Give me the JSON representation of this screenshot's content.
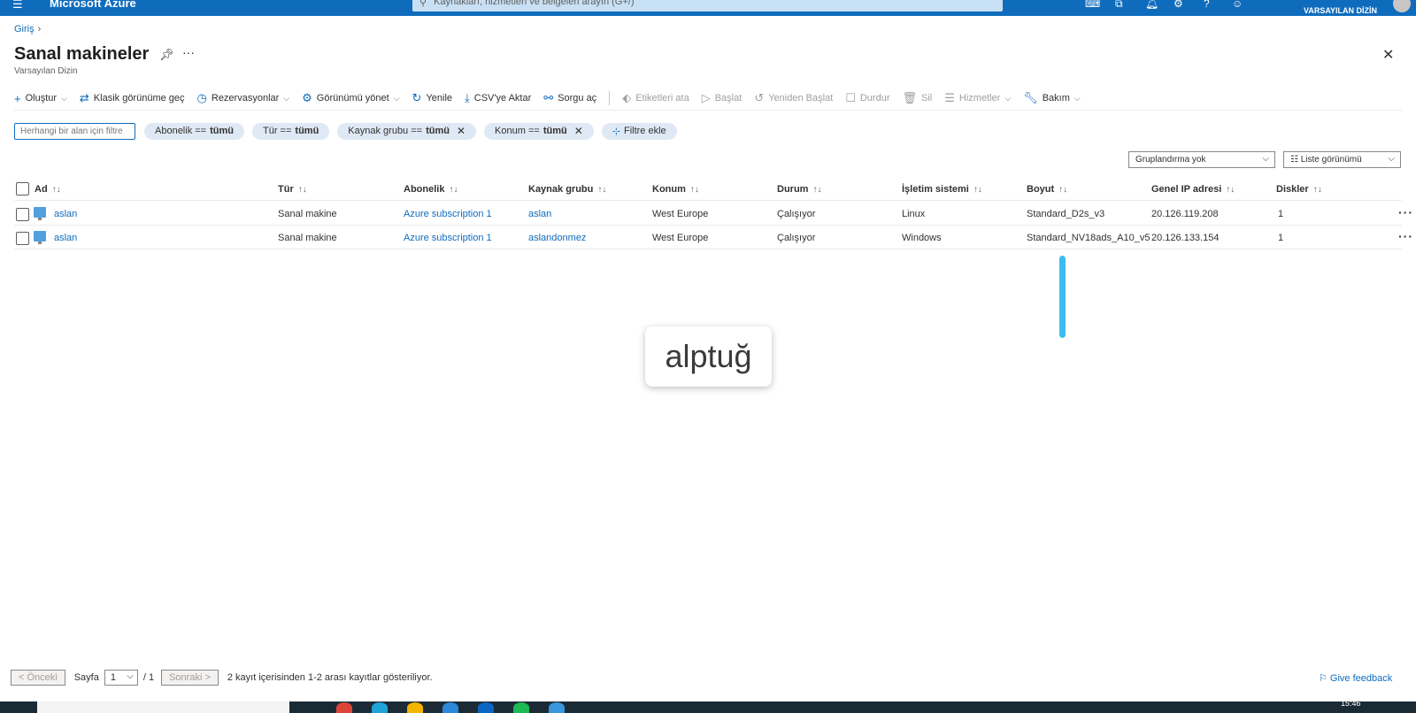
{
  "topbar": {
    "brand": "Microsoft Azure",
    "search_placeholder": "Kaynakları, hizmetleri ve belgeleri arayın (G+/)",
    "user_line2": "VARSAYILAN DİZİN"
  },
  "breadcrumb": {
    "home": "Giriş"
  },
  "page": {
    "title": "Sanal makineler",
    "subtitle": "Varsayılan Dizin"
  },
  "toolbar": {
    "create": "Oluştur",
    "classic": "Klasik görünüme geç",
    "reservations": "Rezervasyonlar",
    "manage_view": "Görünümü yönet",
    "refresh": "Yenile",
    "export_csv": "CSV'ye Aktar",
    "open_query": "Sorgu aç",
    "assign_tags": "Etiketleri ata",
    "start": "Başlat",
    "restart": "Yeniden Başlat",
    "stop": "Durdur",
    "delete": "Sil",
    "services": "Hizmetler",
    "maintenance": "Bakım"
  },
  "filters": {
    "input_placeholder": "Herhangi bir alan için filtre",
    "subscription_label": "Abonelik ==",
    "subscription_value": "tümü",
    "type_label": "Tür ==",
    "type_value": "tümü",
    "rg_label": "Kaynak grubu ==",
    "rg_value": "tümü",
    "location_label": "Konum ==",
    "location_value": "tümü",
    "add_filter": "Filtre ekle"
  },
  "view": {
    "grouping": "Gruplandırma yok",
    "list_view": "Liste görünümü"
  },
  "table": {
    "headers": [
      "Ad",
      "Tür",
      "Abonelik",
      "Kaynak grubu",
      "Konum",
      "Durum",
      "İşletim sistemi",
      "Boyut",
      "Genel IP adresi",
      "Diskler"
    ],
    "rows": [
      [
        "aslan",
        "Sanal makine",
        "Azure subscription 1",
        "aslan",
        "West Europe",
        "Çalışıyor",
        "Linux",
        "Standard_D2s_v3",
        "20.126.119.208",
        "1"
      ],
      [
        "aslan",
        "Sanal makine",
        "Azure subscription 1",
        "aslandonmez",
        "West Europe",
        "Çalışıyor",
        "Windows",
        "Standard_NV18ads_A10_v5",
        "20.126.133.154",
        "1"
      ]
    ]
  },
  "overlay": {
    "text": "alptuğ"
  },
  "pager": {
    "prev": "< Önceki",
    "page_label": "Sayfa",
    "page_value": "1",
    "page_total": "/ 1",
    "next": "Sonraki >",
    "summary": "2 kayıt içerisinden 1-2 arası kayıtlar gösteriliyor."
  },
  "feedback": "Give feedback",
  "taskbar": {
    "time": "15:46"
  },
  "colors": {
    "accent": "#0f6cbd",
    "topbar": "#0f6cbd",
    "pill": "#dfe9f5",
    "scroll_indicator": "#3cbdf1"
  }
}
